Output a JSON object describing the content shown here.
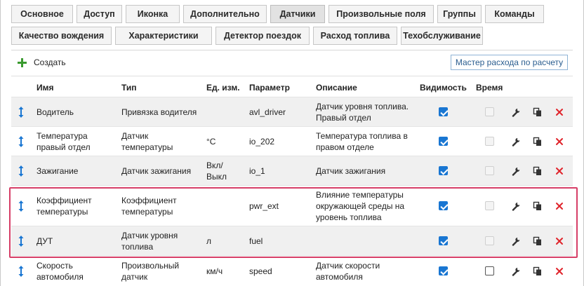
{
  "tabs_row1": [
    {
      "label": "Основное",
      "active": false
    },
    {
      "label": "Доступ",
      "active": false
    },
    {
      "label": "Иконка",
      "active": false
    },
    {
      "label": "Дополнительно",
      "active": false
    },
    {
      "label": "Датчики",
      "active": true
    },
    {
      "label": "Произвольные поля",
      "active": false
    },
    {
      "label": "Группы",
      "active": false
    },
    {
      "label": "Команды",
      "active": false
    }
  ],
  "tabs_row2": [
    {
      "label": "Качество вождения",
      "active": false
    },
    {
      "label": "Характеристики",
      "active": false
    },
    {
      "label": "Детектор поездок",
      "active": false
    },
    {
      "label": "Расход топлива",
      "active": false
    },
    {
      "label": "Техобслуживание",
      "active": false
    }
  ],
  "toolbar": {
    "create_label": "Создать",
    "create_icon": "plus-icon",
    "wizard_label": "Мастер расхода по расчету"
  },
  "table": {
    "columns": [
      "Имя",
      "Тип",
      "Ед. изм.",
      "Параметр",
      "Описание",
      "Видимость",
      "Время"
    ],
    "rows": [
      {
        "name": [
          "Водитель"
        ],
        "type": [
          "Привязка водителя"
        ],
        "unit": [
          ""
        ],
        "param": "avl_driver",
        "desc": [
          "Датчик уровня топлива.",
          "Правый отдел"
        ],
        "visible": true,
        "time": "disabled"
      },
      {
        "name": [
          "Температура",
          "правый отдел"
        ],
        "type": [
          "Датчик",
          "температуры"
        ],
        "unit": [
          "°C"
        ],
        "param": "io_202",
        "desc": [
          "Температура топлива в",
          "правом отделе"
        ],
        "visible": true,
        "time": "disabled"
      },
      {
        "name": [
          "Зажигание"
        ],
        "type": [
          "Датчик зажигания"
        ],
        "unit": [
          "Вкл/",
          "Выкл"
        ],
        "param": "io_1",
        "desc": [
          "Датчик зажигания"
        ],
        "visible": true,
        "time": "disabled"
      },
      {
        "name": [
          "Коэффициент",
          "температуры"
        ],
        "type": [
          "Коэффициент",
          "температуры"
        ],
        "unit": [
          ""
        ],
        "param": "pwr_ext",
        "desc": [
          "Влияние температуры",
          "окружающей среды на",
          "уровень топлива"
        ],
        "visible": true,
        "time": "disabled"
      },
      {
        "name": [
          "ДУТ"
        ],
        "type": [
          "Датчик уровня",
          "топлива"
        ],
        "unit": [
          "л"
        ],
        "param": "fuel",
        "desc": [
          ""
        ],
        "visible": true,
        "time": "disabled"
      },
      {
        "name": [
          "Скорость",
          "автомобиля"
        ],
        "type": [
          "Произвольный",
          "датчик"
        ],
        "unit": [
          "км/ч"
        ],
        "param": "speed",
        "desc": [
          "Датчик скорости",
          "автомобиля"
        ],
        "visible": true,
        "time": "off"
      }
    ]
  },
  "colors": {
    "accent_blue": "#1976d2",
    "plus_green": "#3a9a2f",
    "delete_red": "#e0242b",
    "highlight_border": "#d63e67"
  },
  "icons": {
    "drag": "drag-handle-icon",
    "edit": "wrench-icon",
    "copy": "copy-icon",
    "delete": "close-icon"
  }
}
